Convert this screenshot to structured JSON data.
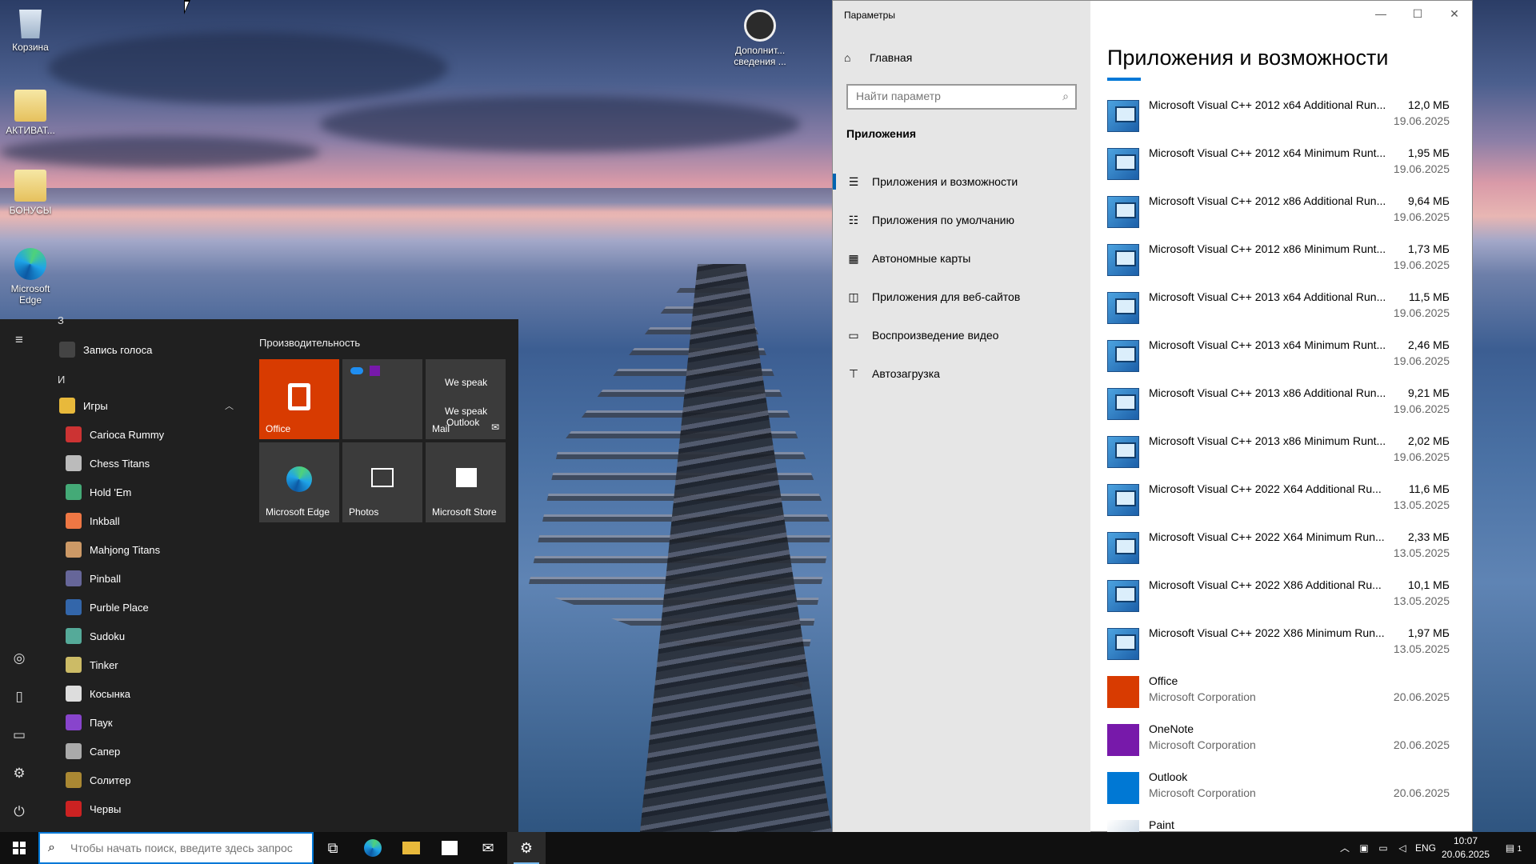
{
  "desktop": {
    "icons": [
      {
        "label": "Корзина",
        "icon": "recycle-bin-icon"
      },
      {
        "label": "АКТИВАТ...",
        "icon": "folder-icon"
      },
      {
        "label": "БОНУСЫ",
        "icon": "folder-icon"
      },
      {
        "label": "Microsoft Edge",
        "icon": "edge-icon"
      },
      {
        "label": "Дополнит... сведения ...",
        "icon": "info-icon"
      }
    ]
  },
  "start_menu": {
    "rail": [
      "menu-icon",
      "user-icon",
      "documents-icon",
      "pictures-icon",
      "settings-icon",
      "power-icon"
    ],
    "list": {
      "letter_z": "З",
      "voice": "Запись голоса",
      "letter_i": "И",
      "games_folder": "Игры",
      "games": [
        "Carioca Rummy",
        "Chess Titans",
        "Hold 'Em",
        "Inkball",
        "Mahjong Titans",
        "Pinball",
        "Purble Place",
        "Sudoku",
        "Tinker",
        "Косынка",
        "Паук",
        "Сапер",
        "Солитер",
        "Червы"
      ]
    },
    "group_title": "Производительность",
    "tiles": {
      "office": "Office",
      "mail_top": "We speak",
      "mail_mid": "We speak",
      "mail_mid2": "Outlook",
      "mail": "Mail",
      "edge": "Microsoft Edge",
      "photos": "Photos",
      "store": "Microsoft Store"
    }
  },
  "settings": {
    "window_title": "Параметры",
    "home": "Главная",
    "search_placeholder": "Найти параметр",
    "section": "Приложения",
    "nav": [
      "Приложения и возможности",
      "Приложения по умолчанию",
      "Автономные карты",
      "Приложения для веб-сайтов",
      "Воспроизведение видео",
      "Автозагрузка"
    ],
    "heading": "Приложения и возможности",
    "apps": [
      {
        "name": "Microsoft Visual C++ 2012 x64 Additional Run...",
        "size": "12,0 МБ",
        "date": "19.06.2025",
        "publisher": ""
      },
      {
        "name": "Microsoft Visual C++ 2012 x64 Minimum Runt...",
        "size": "1,95 МБ",
        "date": "19.06.2025",
        "publisher": ""
      },
      {
        "name": "Microsoft Visual C++ 2012 x86 Additional Run...",
        "size": "9,64 МБ",
        "date": "19.06.2025",
        "publisher": ""
      },
      {
        "name": "Microsoft Visual C++ 2012 x86 Minimum Runt...",
        "size": "1,73 МБ",
        "date": "19.06.2025",
        "publisher": ""
      },
      {
        "name": "Microsoft Visual C++ 2013 x64 Additional Run...",
        "size": "11,5 МБ",
        "date": "19.06.2025",
        "publisher": ""
      },
      {
        "name": "Microsoft Visual C++ 2013 x64 Minimum Runt...",
        "size": "2,46 МБ",
        "date": "19.06.2025",
        "publisher": ""
      },
      {
        "name": "Microsoft Visual C++ 2013 x86 Additional Run...",
        "size": "9,21 МБ",
        "date": "19.06.2025",
        "publisher": ""
      },
      {
        "name": "Microsoft Visual C++ 2013 x86 Minimum Runt...",
        "size": "2,02 МБ",
        "date": "19.06.2025",
        "publisher": ""
      },
      {
        "name": "Microsoft Visual C++ 2022 X64 Additional Ru...",
        "size": "11,6 МБ",
        "date": "13.05.2025",
        "publisher": ""
      },
      {
        "name": "Microsoft Visual C++ 2022 X64 Minimum Run...",
        "size": "2,33 МБ",
        "date": "13.05.2025",
        "publisher": ""
      },
      {
        "name": "Microsoft Visual C++ 2022 X86 Additional Ru...",
        "size": "10,1 МБ",
        "date": "13.05.2025",
        "publisher": ""
      },
      {
        "name": "Microsoft Visual C++ 2022 X86 Minimum Run...",
        "size": "1,97 МБ",
        "date": "13.05.2025",
        "publisher": ""
      },
      {
        "name": "Office",
        "size": "",
        "date": "20.06.2025",
        "publisher": "Microsoft Corporation"
      },
      {
        "name": "OneNote",
        "size": "",
        "date": "20.06.2025",
        "publisher": "Microsoft Corporation"
      },
      {
        "name": "Outlook",
        "size": "",
        "date": "20.06.2025",
        "publisher": "Microsoft Corporation"
      },
      {
        "name": "Paint",
        "size": "",
        "date": "",
        "publisher": ""
      }
    ]
  },
  "taskbar": {
    "search_placeholder": "Чтобы начать поиск, введите здесь запрос",
    "lang": "ENG",
    "time": "10:07",
    "date": "20.06.2025",
    "notifications": "1"
  }
}
